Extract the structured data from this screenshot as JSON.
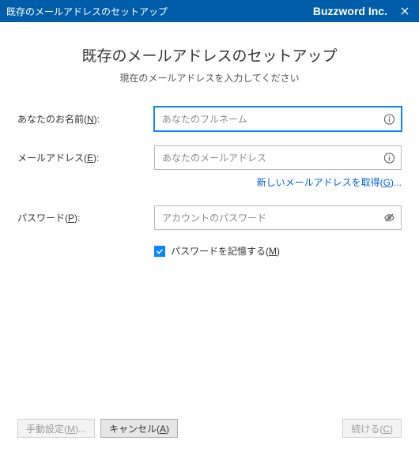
{
  "titlebar": {
    "title": "既存のメールアドレスのセットアップ",
    "brand": "Buzzword Inc."
  },
  "header": {
    "main_title": "既存のメールアドレスのセットアップ",
    "subtitle": "現在のメールアドレスを入力してください"
  },
  "form": {
    "name": {
      "label_pre": "あなたのお名前(",
      "label_key": "N",
      "label_post": "):",
      "placeholder": "あなたのフルネーム",
      "value": ""
    },
    "email": {
      "label_pre": "メールアドレス(",
      "label_key": "E",
      "label_post": "):",
      "placeholder": "あなたのメールアドレス",
      "value": ""
    },
    "get_new_link_pre": "新しいメールアドレスを取得(",
    "get_new_link_key": "G",
    "get_new_link_post": ")...",
    "password": {
      "label_pre": "パスワード(",
      "label_key": "P",
      "label_post": "):",
      "placeholder": "アカウントのパスワード",
      "value": ""
    },
    "remember": {
      "checked": true,
      "label_pre": "パスワードを記憶する(",
      "label_key": "M",
      "label_post": ")"
    }
  },
  "footer": {
    "manual_pre": "手動設定(",
    "manual_key": "M",
    "manual_post": ")...",
    "cancel_pre": "キャンセル(",
    "cancel_key": "A",
    "cancel_post": ")",
    "continue_pre": "続ける(",
    "continue_key": "C",
    "continue_post": ")"
  }
}
